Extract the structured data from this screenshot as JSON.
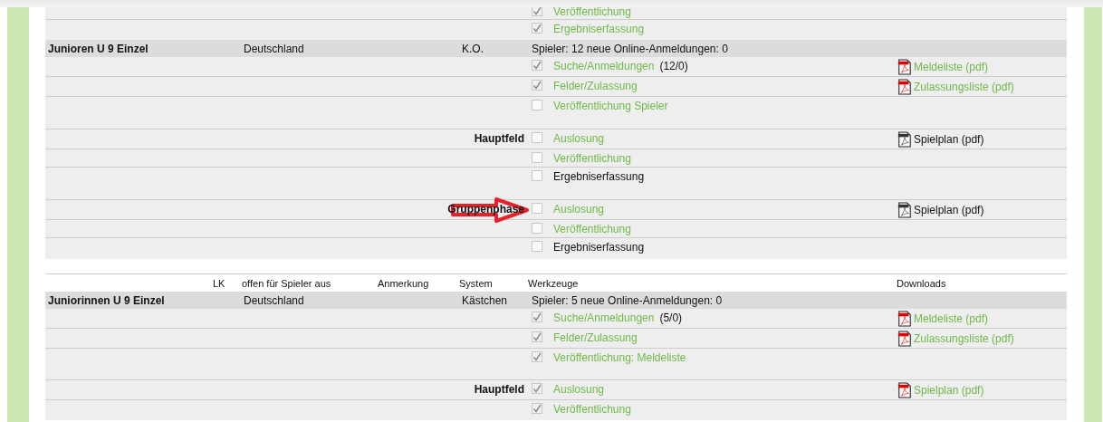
{
  "sections": [
    {
      "groups": [
        {
          "items": [
            {
              "checked": true,
              "tool": "Veröffentlichung",
              "link": true
            },
            {
              "checked": true,
              "tool": "Ergebniserfassung",
              "link": true
            }
          ]
        }
      ]
    },
    {
      "category": {
        "name": "Junioren U 9 Einzel",
        "country": "Deutschland",
        "system": "K.O.",
        "summary": "Spieler: 12  neue Online-Anmeldungen: 0"
      },
      "groups": [
        {
          "items": [
            {
              "checked": true,
              "tool": "Suche/Anmeldungen",
              "link": true,
              "count": "(12/0)",
              "download": {
                "label": "Meldeliste (pdf)",
                "available": true
              }
            },
            {
              "checked": true,
              "tool": "Felder/Zulassung",
              "link": true,
              "download": {
                "label": "Zulassungsliste (pdf)",
                "available": true
              }
            },
            {
              "checked": false,
              "tool": "Veröffentlichung Spieler",
              "link": true
            }
          ]
        },
        {
          "label": "Hauptfeld",
          "items": [
            {
              "checked": false,
              "tool": "Auslosung",
              "link": true,
              "download": {
                "label": "Spielplan (pdf)",
                "available": false
              }
            },
            {
              "checked": false,
              "tool": "Veröffentlichung",
              "link": true
            },
            {
              "checked": false,
              "tool": "Ergebniserfassung",
              "link": false
            }
          ]
        },
        {
          "label": "Gruppenphase",
          "marked": true,
          "items": [
            {
              "checked": false,
              "tool": "Auslosung",
              "link": true,
              "download": {
                "label": "Spielplan (pdf)",
                "available": false
              }
            },
            {
              "checked": false,
              "tool": "Veröffentlichung",
              "link": true
            },
            {
              "checked": false,
              "tool": "Ergebniserfassung",
              "link": false
            }
          ]
        }
      ]
    },
    {
      "columns": [
        "LK",
        "offen für Spieler aus",
        "Anmerkung",
        "System",
        "Werkzeuge",
        "Downloads"
      ],
      "category": {
        "name": "Juniorinnen U 9 Einzel",
        "country": "Deutschland",
        "system": "Kästchen",
        "summary": "Spieler: 5  neue Online-Anmeldungen: 0"
      },
      "groups": [
        {
          "items": [
            {
              "checked": true,
              "tool": "Suche/Anmeldungen",
              "link": true,
              "count": "(5/0)",
              "download": {
                "label": "Meldeliste (pdf)",
                "available": true
              }
            },
            {
              "checked": true,
              "tool": "Felder/Zulassung",
              "link": true,
              "download": {
                "label": "Zulassungsliste (pdf)",
                "available": true
              }
            },
            {
              "checked": true,
              "tool": "Veröffentlichung: Meldeliste",
              "link": true
            }
          ]
        },
        {
          "label": "Hauptfeld",
          "items": [
            {
              "checked": true,
              "tool": "Auslosung",
              "link": true,
              "download": {
                "label": "Spielplan (pdf)",
                "available": true
              }
            },
            {
              "checked": true,
              "tool": "Veröffentlichung",
              "link": true
            }
          ]
        }
      ]
    }
  ]
}
